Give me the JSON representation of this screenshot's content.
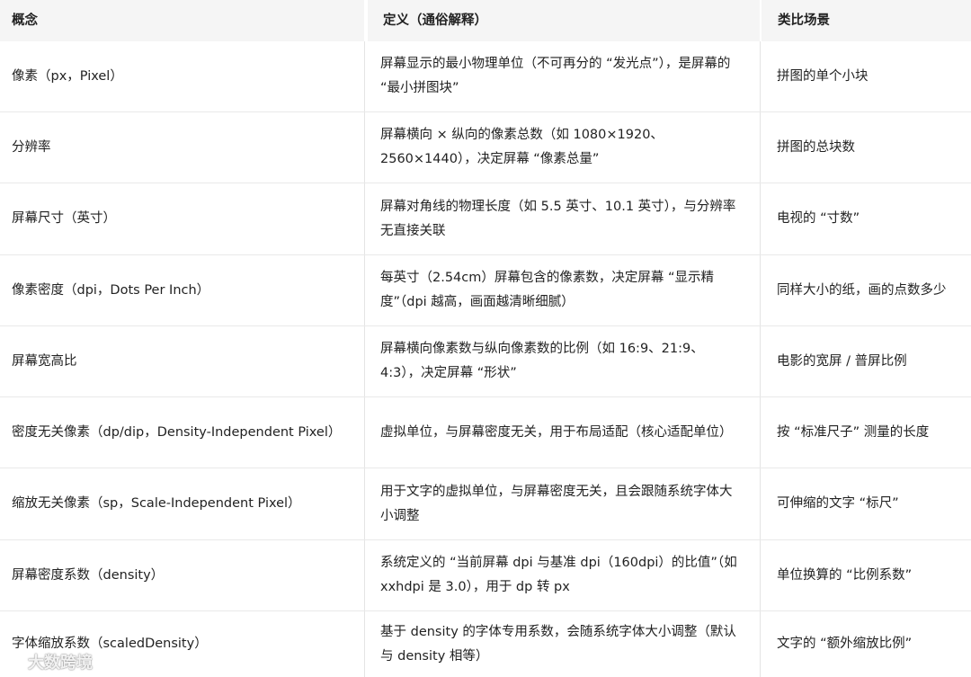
{
  "header": {
    "col1": "概念",
    "col2": "定义（通俗解释）",
    "col3": "类比场景"
  },
  "rows": [
    {
      "concept": "像素（px，Pixel）",
      "definition": "屏幕显示的最小物理单位（不可再分的 “发光点”），是屏幕的 “最小拼图块”",
      "analogy": "拼图的单个小块"
    },
    {
      "concept": "分辨率",
      "definition": "屏幕横向 × 纵向的像素总数（如 1080×1920、2560×1440），决定屏幕 “像素总量”",
      "analogy": "拼图的总块数"
    },
    {
      "concept": "屏幕尺寸（英寸）",
      "definition": "屏幕对角线的物理长度（如 5.5 英寸、10.1 英寸），与分辨率无直接关联",
      "analogy": "电视的 “寸数”"
    },
    {
      "concept": "像素密度（dpi，Dots Per Inch）",
      "definition": "每英寸（2.54cm）屏幕包含的像素数，决定屏幕 “显示精度”（dpi 越高，画面越清晰细腻）",
      "analogy": "同样大小的纸，画的点数多少"
    },
    {
      "concept": "屏幕宽高比",
      "definition": "屏幕横向像素数与纵向像素数的比例（如 16:9、21:9、4:3），决定屏幕 “形状”",
      "analogy": "电影的宽屏 / 普屏比例"
    },
    {
      "concept": "密度无关像素（dp/dip，Density-Independent Pixel）",
      "definition": "虚拟单位，与屏幕密度无关，用于布局适配（核心适配单位）",
      "analogy": "按 “标准尺子” 测量的长度"
    },
    {
      "concept": "缩放无关像素（sp，Scale-Independent Pixel）",
      "definition": "用于文字的虚拟单位，与屏幕密度无关，且会跟随系统字体大小调整",
      "analogy": "可伸缩的文字 “标尺”"
    },
    {
      "concept": "屏幕密度系数（density）",
      "definition": "系统定义的 “当前屏幕 dpi 与基准 dpi（160dpi）的比值”（如 xxhdpi 是 3.0），用于 dp 转 px",
      "analogy": "单位换算的 “比例系数”"
    },
    {
      "concept": "字体缩放系数（scaledDensity）",
      "definition": "基于 density 的字体专用系数，会随系统字体大小调整（默认与 density 相等）",
      "analogy": "文字的 “额外缩放比例”"
    }
  ],
  "watermark": {
    "text": "大数跨境",
    "icon": "brand-logo-icon"
  }
}
